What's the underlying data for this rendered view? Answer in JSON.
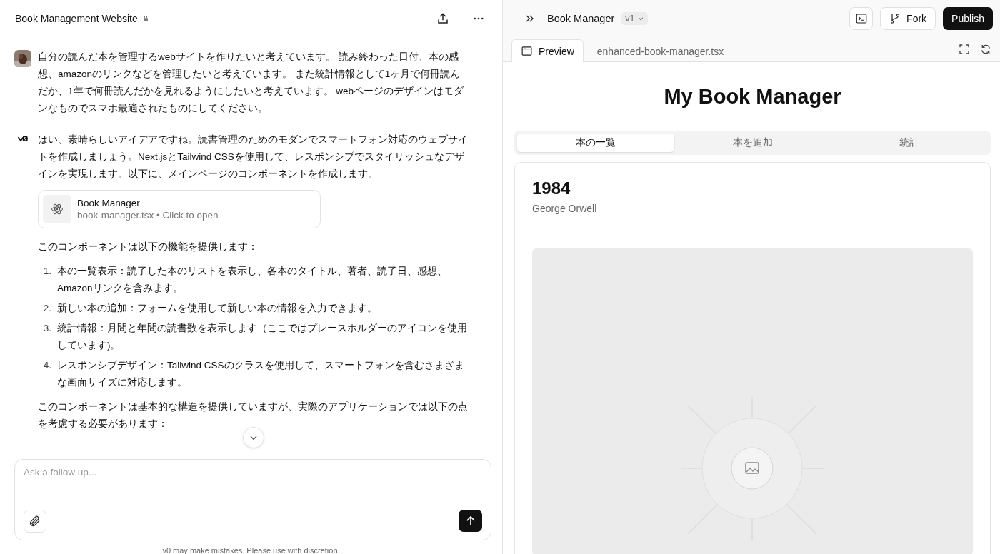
{
  "chat": {
    "title": "Book Management Website",
    "locked": true,
    "messages": [
      {
        "kind": "user",
        "text": "自分の読んだ本を管理するwebサイトを作りたいと考えています。 読み終わった日付、本の感想、amazonのリンクなどを管理したいと考えています。 また統計情報として1ヶ月で何冊読んだか、1年で何冊読んだかを見れるようにしたいと考えています。 webページのデザインはモダンなものでスマホ最適されたものにしてください。"
      },
      {
        "kind": "assistant",
        "blocks": [
          {
            "kind": "paragraph",
            "text": "はい、素晴らしいアイデアですね。読書管理のためのモダンでスマートフォン対応のウェブサイトを作成しましょう。Next.jsとTailwind CSSを使用して、レスポンシブでスタイリッシュなデザインを実現します。以下に、メインページのコンポーネントを作成します。"
          },
          {
            "kind": "file",
            "title": "Book Manager",
            "subtitle": "book-manager.tsx • Click to open"
          },
          {
            "kind": "paragraph",
            "text": "このコンポーネントは以下の機能を提供します："
          },
          {
            "kind": "list",
            "items": [
              {
                "number": "1.",
                "text": "本の一覧表示：読了した本のリストを表示し、各本のタイトル、著者、読了日、感想、Amazonリンクを含みます。"
              },
              {
                "number": "2.",
                "text": "新しい本の追加：フォームを使用して新しい本の情報を入力できます。"
              },
              {
                "number": "3.",
                "text": "統計情報：月間と年間の読書数を表示します（ここではプレースホルダーのアイコンを使用しています)。"
              },
              {
                "number": "4.",
                "text": "レスポンシブデザイン：Tailwind CSSのクラスを使用して、スマートフォンを含むさまざまな画面サイズに対応します。"
              }
            ]
          },
          {
            "kind": "paragraph",
            "text": "このコンポーネントは基本的な構造を提供していますが、実際のアプリケーションでは以下の点を考慮する必要があります："
          }
        ]
      }
    ],
    "input": {
      "placeholder": "Ask a follow up..."
    },
    "disclaimer": "v0 may make mistakes. Please use with discretion."
  },
  "preview": {
    "project": "Book Manager",
    "version": "v1",
    "fork": "Fork",
    "publish": "Publish",
    "tabs": [
      {
        "label": "Preview",
        "selected": true
      },
      {
        "label": "enhanced-book-manager.tsx",
        "selected": false
      }
    ],
    "app": {
      "title": "My Book Manager",
      "tabs": [
        {
          "label": "本の一覧",
          "selected": true
        },
        {
          "label": "本を追加",
          "selected": false
        },
        {
          "label": "統計",
          "selected": false
        }
      ],
      "book": {
        "title": "1984",
        "author": "George Orwell"
      }
    }
  }
}
